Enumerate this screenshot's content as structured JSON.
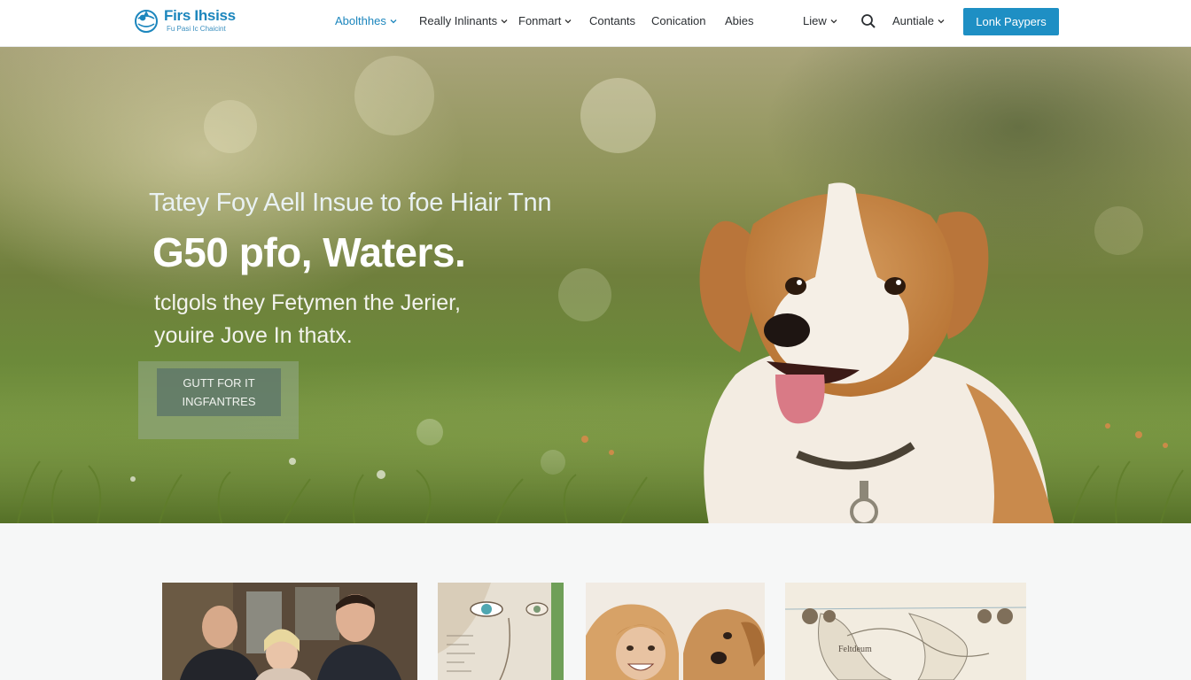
{
  "brand": {
    "name": "Firs Ihsiss",
    "tagline": "Fu Pasi Ic Chaicint",
    "accent": "#1c86bd"
  },
  "nav": {
    "items": [
      {
        "label": "Abolthhes",
        "dropdown": true,
        "active": true
      },
      {
        "label": "Really Inlinants",
        "dropdown": true,
        "active": false
      },
      {
        "label": "Fonmart",
        "dropdown": true,
        "active": false
      },
      {
        "label": "Contants",
        "dropdown": false,
        "active": false
      },
      {
        "label": "Conication",
        "dropdown": false,
        "active": false
      },
      {
        "label": "Abies",
        "dropdown": false,
        "active": false
      },
      {
        "label": "Liew",
        "dropdown": true,
        "active": false
      },
      {
        "label": "Auntiale",
        "dropdown": true,
        "active": false
      }
    ],
    "search_icon": "search-icon",
    "cta_label": "Lonk Paypers",
    "cta_color": "#1e8fc4"
  },
  "hero": {
    "kicker": "Tatey Foy Aell Insue to foe Hiair Tnn",
    "title": "G50 pfo, Waters.",
    "subtitle": "tclgols they Fetymen the Jerier, youire Jove In thatx.",
    "cta_label": "GUTT FOR IT INGFANTRES"
  },
  "cards": [
    {
      "name": "card-people"
    },
    {
      "name": "card-eye-illustration"
    },
    {
      "name": "card-dogs"
    },
    {
      "name": "card-map",
      "label": "Feltdeum"
    }
  ]
}
